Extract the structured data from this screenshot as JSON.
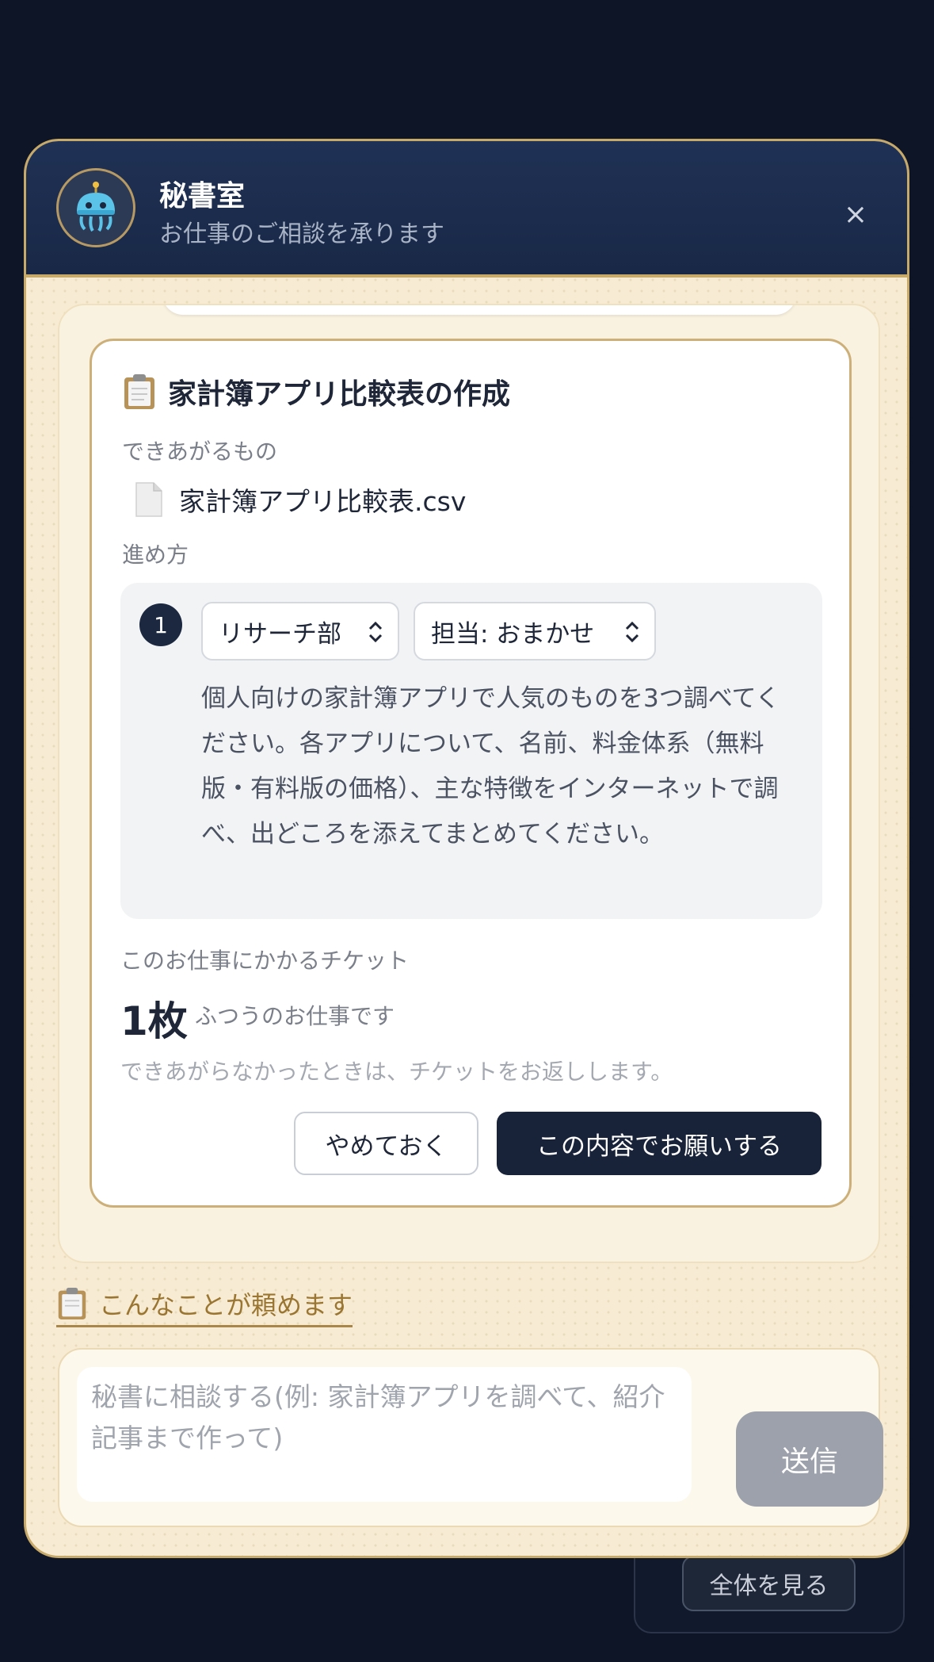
{
  "header": {
    "title": "秘書室",
    "subtitle": "お仕事のご相談を承ります",
    "close_symbol": "×",
    "avatar_icon": "robot-jellyfish-icon"
  },
  "task": {
    "title": "家計簿アプリ比較表の作成",
    "title_icon": "clipboard-icon",
    "deliverables_label": "できあがるもの",
    "deliverable_file": "家計簿アプリ比較表.csv",
    "deliverable_icon": "document-icon",
    "steps_label": "進め方",
    "steps": [
      {
        "number": "1",
        "department": "リサーチ部",
        "assignee": "担当: おまかせ",
        "description": "個人向けの家計簿アプリで人気のものを3つ調べてください。各アプリについて、名前、料金体系（無料版・有料版の価格）、主な特徴をインターネットで調べ、出どころを添えてまとめてください。"
      }
    ],
    "ticket_label": "このお仕事にかかるチケット",
    "ticket_count": "1枚",
    "ticket_kind": "ふつうのお仕事です",
    "refund_note": "できあがらなかったときは、チケットをお返しします。",
    "cancel_label": "やめておく",
    "confirm_label": "この内容でお願いする"
  },
  "examples": {
    "label": "こんなことが頼めます",
    "icon": "clipboard-icon"
  },
  "composer": {
    "placeholder": "秘書に相談する(例: 家計簿アプリを調べて、紹介記事まで作って)",
    "value": "",
    "send_label": "送信"
  },
  "background": {
    "view_all_label": "全体を見る"
  },
  "colors": {
    "navy": "#1b2840",
    "gold": "#c7a96a",
    "cream": "#f7ecd3",
    "send_disabled": "#9ca1ab"
  }
}
